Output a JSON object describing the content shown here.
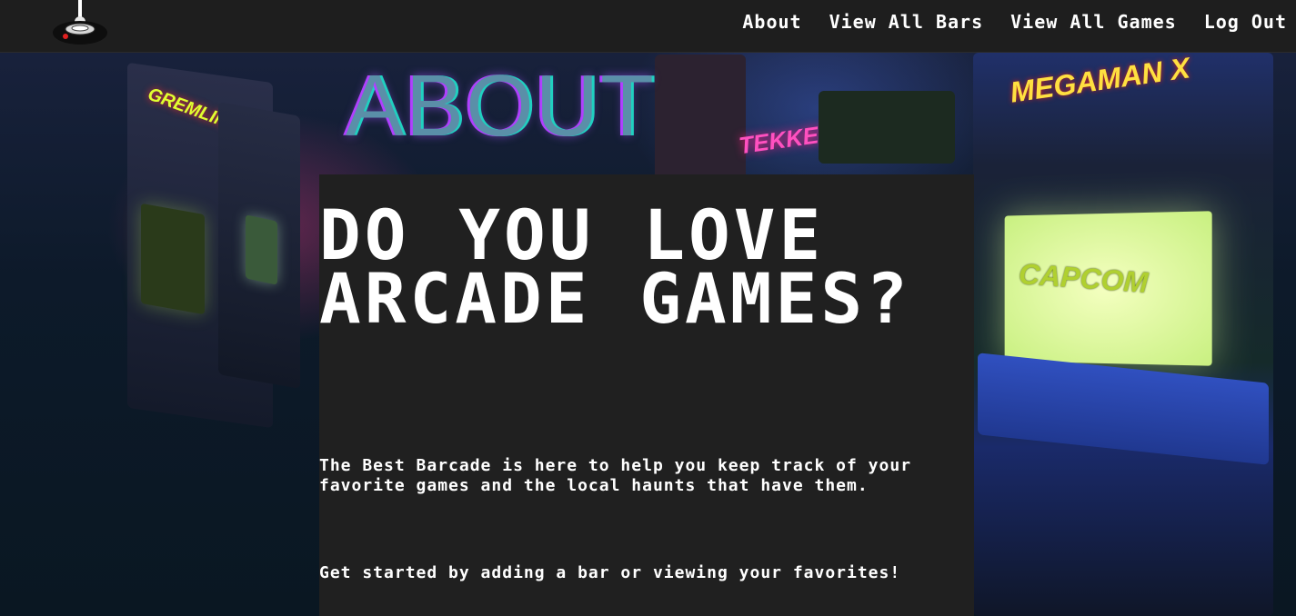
{
  "nav": {
    "logo_icon": "joystick-icon",
    "links": [
      {
        "label": "About"
      },
      {
        "label": "View All Bars"
      },
      {
        "label": "View All Games"
      },
      {
        "label": "Log Out"
      }
    ]
  },
  "hero": {
    "heading": "ABOUT"
  },
  "panel": {
    "title": "DO YOU LOVE ARCADE GAMES?",
    "paragraph1": "The Best Barcade is here to help you keep track of your favorite games and the local haunts that have them.",
    "paragraph2": "Get started by adding a bar or viewing your favorites!"
  },
  "background": {
    "screen_logo": "CAPCOM",
    "marquee_left": "GREMLINS",
    "marquee_mid": "TEKKEN",
    "marquee_right": "MEGAMAN X"
  },
  "colors": {
    "navbar": "#1e1e1e",
    "panel": "#202020",
    "text": "#ffffff",
    "heading_glow_purple": "#b040ff",
    "heading_glow_cyan": "#20d0c0"
  }
}
